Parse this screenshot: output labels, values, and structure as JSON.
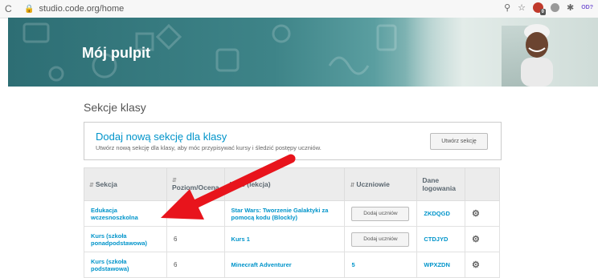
{
  "browser": {
    "reload": "C",
    "url": "studio.code.org/home",
    "ext_badge": "0",
    "ext_text": "OD?"
  },
  "banner": {
    "title": "Mój pulpit"
  },
  "sections": {
    "title": "Sekcje klasy",
    "add": {
      "heading": "Dodaj nową sekcję dla klasy",
      "description": "Utwórz nową sekcję dla klasy, aby móc przypisywać kursy i śledzić postępy uczniów.",
      "button": "Utwórz sekcję"
    },
    "table": {
      "headers": [
        "Sekcja",
        "Poziom/Ocena",
        "Kurs (lekcja)",
        "Uczniowie",
        "Dane logowania",
        ""
      ],
      "rows": [
        {
          "name": "Edukacja wczesnoszkolna",
          "level": "",
          "course": "Star Wars: Tworzenie Galaktyki za pomocą kodu (Blockly)",
          "students": "Dodaj uczniów",
          "login": "ZKDQGD"
        },
        {
          "name": "Kurs (szkoła ponadpodstawowa)",
          "level": "6",
          "course": "Kurs 1",
          "students": "Dodaj uczniów",
          "login": "CTDJYD"
        },
        {
          "name": "Kurs (szkoła podstawowa)",
          "level": "6",
          "course": "Minecraft Adventurer",
          "students": "5",
          "login": "WPXZDN"
        }
      ]
    }
  },
  "colors": {
    "accent": "#0094ca",
    "arrow": "#e8141c",
    "banner": "#2d6e74"
  }
}
